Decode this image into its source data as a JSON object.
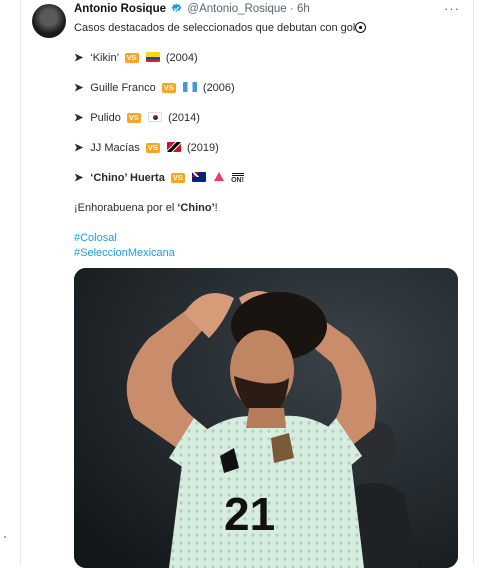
{
  "tweet": {
    "author_name": "Antonio Rosique",
    "handle": "@Antonio_Rosique",
    "separator": "·",
    "time": "6h",
    "intro": "Casos destacados de seleccionados que debutan con gol",
    "intro_emoji": "soccer-ball",
    "cases": [
      {
        "player": "‘Kikin’",
        "vs": "VS",
        "flag": "ecuador-flag",
        "year": "(2004)"
      },
      {
        "player": "Guille Franco",
        "vs": "VS",
        "flag": "guatemala-flag",
        "year": "(2006)"
      },
      {
        "player": "Pulido",
        "vs": "VS",
        "flag": "south-korea-flag",
        "year": "(2014)"
      },
      {
        "player": "JJ Macías",
        "vs": "VS",
        "flag": "trinidad-tobago-flag",
        "year": "(2019)"
      },
      {
        "player": "‘Chino’ Huerta",
        "vs": "VS",
        "flag": "australia-flag",
        "extra": [
          "red-triangle",
          "on-arrow"
        ],
        "on_label": "ON!"
      }
    ],
    "congrats_prefix": "¡Enhorabuena por el ",
    "congrats_name": "‘Chino’",
    "congrats_suffix": "!",
    "hashtags": [
      "#Colosal",
      "#SeleccionMexicana"
    ],
    "more_label": "···",
    "image_subject": {
      "jersey_number": "21"
    },
    "colors": {
      "vs_badge": "#f6a623",
      "hashtag": "#1d9bf0",
      "verified": "#1d9bf0"
    }
  }
}
